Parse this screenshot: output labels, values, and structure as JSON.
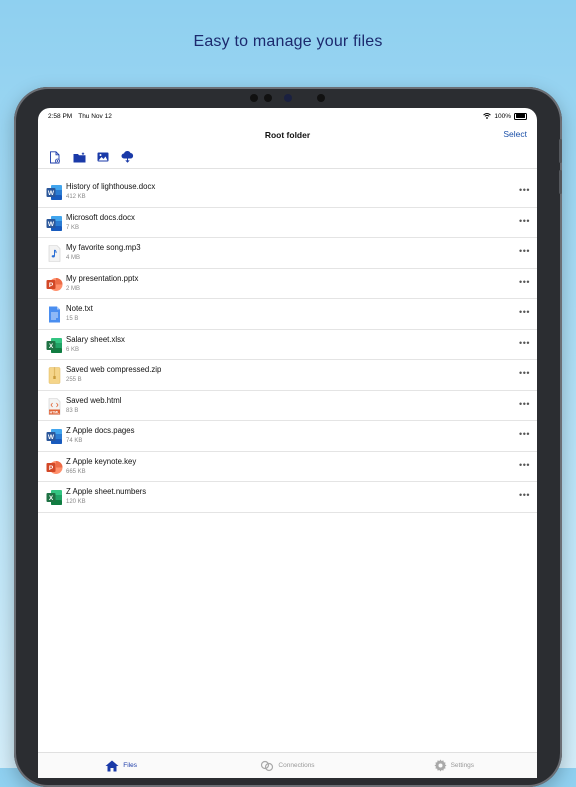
{
  "headline": "Easy to manage your files",
  "status_bar": {
    "time": "2:58 PM",
    "date": "Thu Nov 12",
    "battery": "100%"
  },
  "navbar": {
    "title": "Root folder",
    "select_label": "Select"
  },
  "toolbar": [
    "new-file-icon",
    "new-folder-icon",
    "photo-import-icon",
    "cloud-download-icon"
  ],
  "files": [
    {
      "name": "History of lighthouse.docx",
      "size": "412 KB",
      "icon": "word-icon"
    },
    {
      "name": "Microsoft docs.docx",
      "size": "7 KB",
      "icon": "word-icon"
    },
    {
      "name": "My favorite song.mp3",
      "size": "4 MB",
      "icon": "audio-icon"
    },
    {
      "name": "My presentation.pptx",
      "size": "2 MB",
      "icon": "powerpoint-icon"
    },
    {
      "name": "Note.txt",
      "size": "15 B",
      "icon": "text-icon"
    },
    {
      "name": "Salary sheet.xlsx",
      "size": "6 KB",
      "icon": "excel-icon"
    },
    {
      "name": "Saved web compressed.zip",
      "size": "255 B",
      "icon": "zip-icon"
    },
    {
      "name": "Saved web.html",
      "size": "83 B",
      "icon": "html-icon"
    },
    {
      "name": "Z Apple docs.pages",
      "size": "74 KB",
      "icon": "word-icon"
    },
    {
      "name": "Z Apple keynote.key",
      "size": "665 KB",
      "icon": "powerpoint-icon"
    },
    {
      "name": "Z Apple sheet.numbers",
      "size": "120 KB",
      "icon": "excel-icon"
    }
  ],
  "more_label": "•••",
  "tabs": [
    {
      "label": "Files",
      "icon": "home-icon",
      "active": true
    },
    {
      "label": "Connections",
      "icon": "link-icon",
      "active": false
    },
    {
      "label": "Settings",
      "icon": "gear-icon",
      "active": false
    }
  ],
  "colors": {
    "accent": "#1a3aa8",
    "word": "#2b579a",
    "excel": "#1f7244",
    "powerpoint": "#d24726"
  }
}
